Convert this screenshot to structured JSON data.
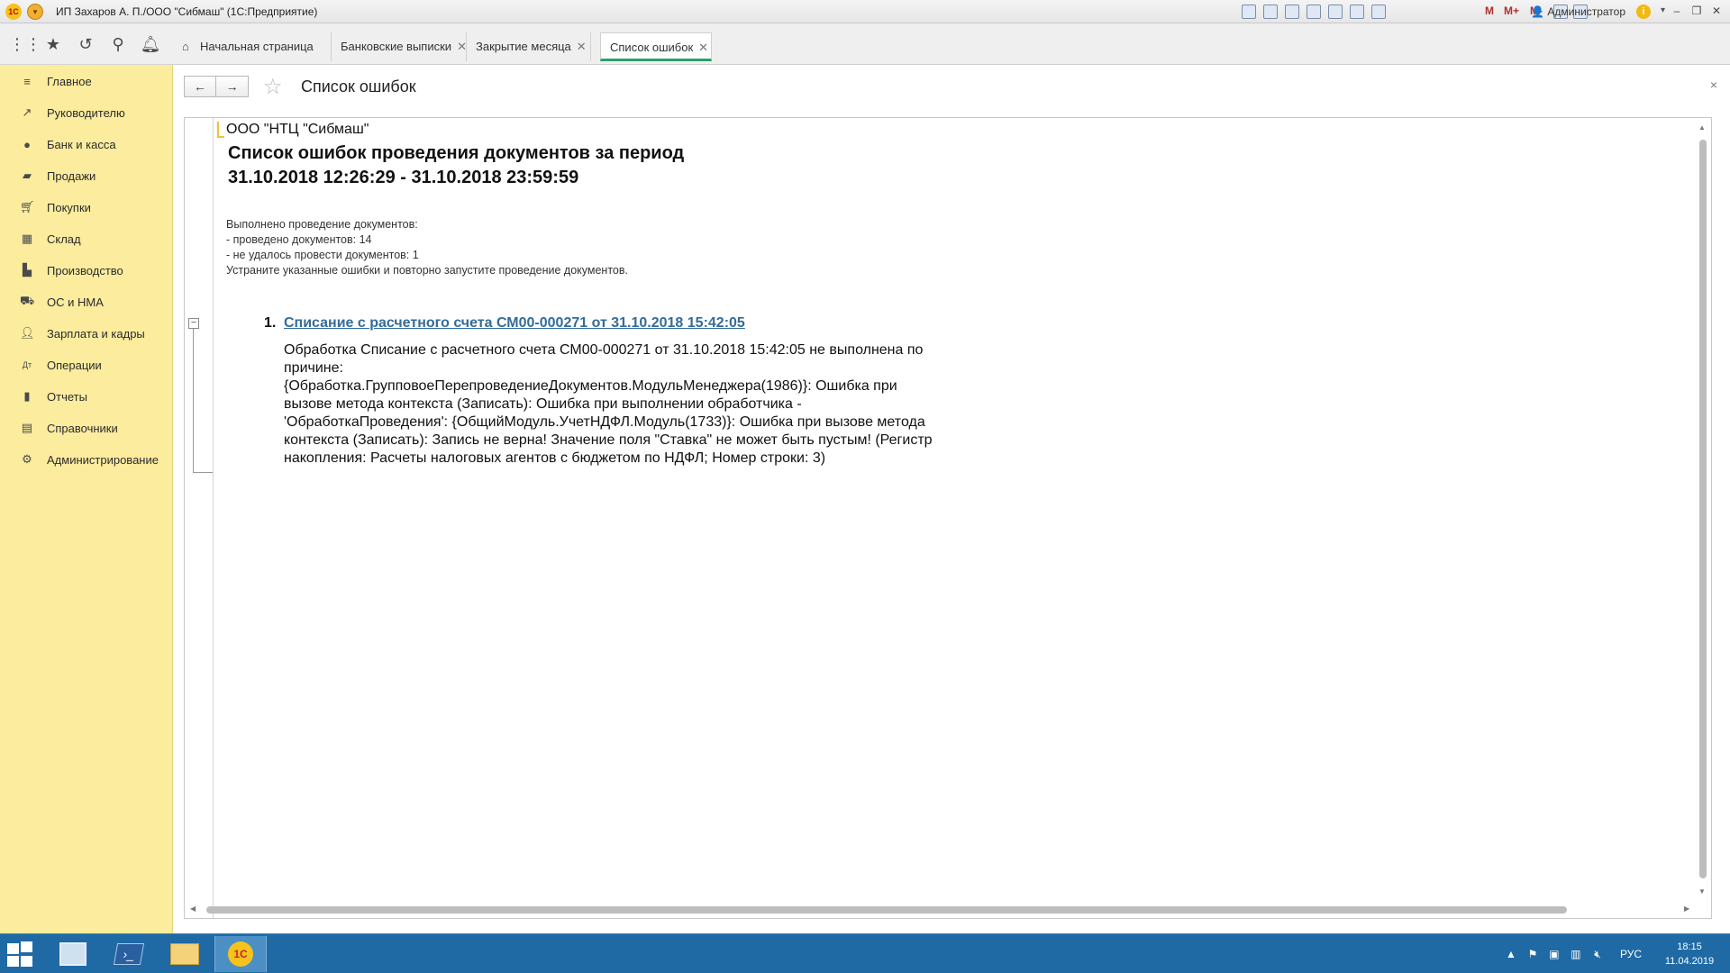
{
  "window": {
    "title": "ИП Захаров А. П./ООО \"Сибмаш\"  (1С:Предприятие)",
    "user": "Администратор",
    "m_buttons": [
      "M",
      "M+",
      "M-"
    ]
  },
  "tabs": [
    {
      "label": "Начальная страница",
      "icon": "home-icon",
      "closable": false,
      "active": false
    },
    {
      "label": "Банковские выписки",
      "closable": true,
      "active": false
    },
    {
      "label": "Закрытие месяца",
      "closable": true,
      "active": false
    },
    {
      "label": "Список ошибок",
      "closable": true,
      "active": true
    }
  ],
  "toolbar_icons": [
    "apps-grid-icon",
    "favorites-star-icon",
    "history-icon",
    "search-icon",
    "notifications-bell-icon"
  ],
  "sidebar": {
    "items": [
      {
        "label": "Главное",
        "icon": "menu-lines-icon"
      },
      {
        "label": "Руководителю",
        "icon": "trend-chart-icon"
      },
      {
        "label": "Банк и касса",
        "icon": "coin-icon"
      },
      {
        "label": "Продажи",
        "icon": "shopping-bag-icon"
      },
      {
        "label": "Покупки",
        "icon": "cart-icon"
      },
      {
        "label": "Склад",
        "icon": "warehouse-grid-icon"
      },
      {
        "label": "Производство",
        "icon": "factory-icon"
      },
      {
        "label": "ОС и НМА",
        "icon": "truck-icon"
      },
      {
        "label": "Зарплата и кадры",
        "icon": "person-icon"
      },
      {
        "label": "Операции",
        "icon": "debit-credit-icon"
      },
      {
        "label": "Отчеты",
        "icon": "bar-chart-icon"
      },
      {
        "label": "Справочники",
        "icon": "book-icon"
      },
      {
        "label": "Администрирование",
        "icon": "gear-icon"
      }
    ]
  },
  "form": {
    "title": "Список ошибок",
    "close": "×",
    "nav_back": "←",
    "nav_forward": "→",
    "star": "☆"
  },
  "report": {
    "organization": "ООО \"НТЦ \"Сибмаш\"",
    "title_line1": "Список ошибок проведения документов за период",
    "title_line2": "31.10.2018 12:26:29 - 31.10.2018 23:59:59",
    "summary": [
      "Выполнено проведение документов:",
      " - проведено документов: 14",
      " - не удалось провести документов: 1",
      "Устраните указанные ошибки и повторно запустите проведение документов."
    ],
    "errors": [
      {
        "number": "1.",
        "link": "Списание с расчетного счета СМ00-000271 от 31.10.2018 15:42:05",
        "text": [
          "Обработка Списание с расчетного счета СМ00-000271 от 31.10.2018 15:42:05 не выполнена по",
          "причине:",
          "{Обработка.ГрупповоеПерепроведениеДокументов.МодульМенеджера(1986)}: Ошибка при",
          "вызове метода контекста (Записать): Ошибка при выполнении обработчика -",
          "'ОбработкаПроведения': {ОбщийМодуль.УчетНДФЛ.Модуль(1733)}: Ошибка при вызове метода",
          "контекста (Записать): Запись не верна! Значение поля \"Ставка\" не может быть пустым! (Регистр",
          "накопления: Расчеты налоговых агентов с бюджетом по НДФЛ; Номер строки: 3)"
        ]
      }
    ]
  },
  "taskbar": {
    "language": "РУС",
    "time": "18:15",
    "date": "11.04.2019"
  },
  "colors": {
    "sidebar_bg": "#fbec9e",
    "active_tab_underline": "#2e9e6d",
    "link": "#336c99",
    "taskbar": "#1f6aa5"
  }
}
